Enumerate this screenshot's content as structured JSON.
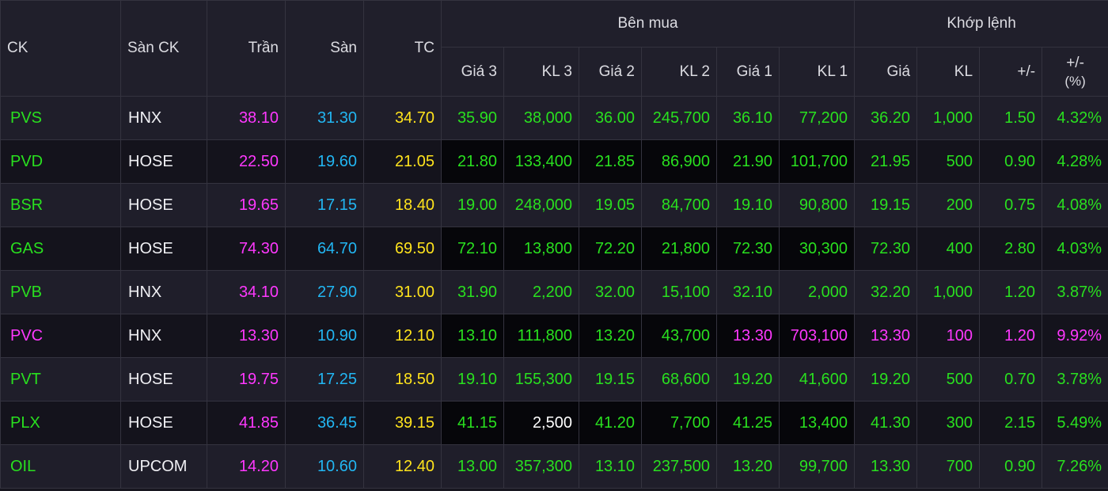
{
  "colors": {
    "ceiling": "#ff38ff",
    "floor": "#22b6f2",
    "reference": "#ffe31c",
    "up": "#29e01f",
    "flash": "#0e9a6a"
  },
  "headers": {
    "ck": "CK",
    "san_ck": "Sàn CK",
    "tran": "Trần",
    "san": "Sàn",
    "tc": "TC",
    "ben_mua": "Bên mua",
    "khop_lenh": "Khớp lệnh",
    "gia3": "Giá 3",
    "kl3": "KL 3",
    "gia2": "Giá 2",
    "kl2": "KL 2",
    "gia1": "Giá 1",
    "kl1": "KL 1",
    "gia": "Giá",
    "kl": "KL",
    "change": "+/-",
    "change_pct_line1": "+/-",
    "change_pct_line2": "(%)"
  },
  "rows": [
    {
      "ck": "PVS",
      "san_ck": "HNX",
      "tran": "38.10",
      "san": "31.30",
      "tc": "34.70",
      "gia3": "35.90",
      "kl3": "38,000",
      "gia2": "36.00",
      "kl2": "245,700",
      "gia1": "36.10",
      "kl1": "77,200",
      "gia": "36.20",
      "kl": "1,000",
      "change": "1.50",
      "change_pct": "4.32%"
    },
    {
      "ck": "PVD",
      "san_ck": "HOSE",
      "tran": "22.50",
      "san": "19.60",
      "tc": "21.05",
      "gia3": "21.80",
      "kl3": "133,400",
      "gia2": "21.85",
      "kl2": "86,900",
      "gia1": "21.90",
      "kl1": "101,700",
      "gia": "21.95",
      "kl": "500",
      "change": "0.90",
      "change_pct": "4.28%"
    },
    {
      "ck": "BSR",
      "san_ck": "HOSE",
      "tran": "19.65",
      "san": "17.15",
      "tc": "18.40",
      "gia3": "19.00",
      "kl3": "248,000",
      "gia2": "19.05",
      "kl2": "84,700",
      "gia1": "19.10",
      "kl1": "90,800",
      "gia": "19.15",
      "kl": "200",
      "change": "0.75",
      "change_pct": "4.08%"
    },
    {
      "ck": "GAS",
      "san_ck": "HOSE",
      "tran": "74.30",
      "san": "64.70",
      "tc": "69.50",
      "gia3": "72.10",
      "kl3": "13,800",
      "gia2": "72.20",
      "kl2": "21,800",
      "gia1": "72.30",
      "kl1": "30,300",
      "gia": "72.30",
      "kl": "400",
      "change": "2.80",
      "change_pct": "4.03%"
    },
    {
      "ck": "PVB",
      "san_ck": "HNX",
      "tran": "34.10",
      "san": "27.90",
      "tc": "31.00",
      "gia3": "31.90",
      "kl3": "2,200",
      "gia2": "32.00",
      "kl2": "15,100",
      "gia1": "32.10",
      "kl1": "2,000",
      "gia": "32.20",
      "kl": "1,000",
      "change": "1.20",
      "change_pct": "3.87%"
    },
    {
      "ck": "PVC",
      "san_ck": "HNX",
      "tran": "13.30",
      "san": "10.90",
      "tc": "12.10",
      "gia3": "13.10",
      "kl3": "111,800",
      "gia2": "13.20",
      "kl2": "43,700",
      "gia1": "13.30",
      "kl1": "703,100",
      "gia": "13.30",
      "kl": "100",
      "change": "1.20",
      "change_pct": "9.92%"
    },
    {
      "ck": "PVT",
      "san_ck": "HOSE",
      "tran": "19.75",
      "san": "17.25",
      "tc": "18.50",
      "gia3": "19.10",
      "kl3": "155,300",
      "gia2": "19.15",
      "kl2": "68,600",
      "gia1": "19.20",
      "kl1": "41,600",
      "gia": "19.20",
      "kl": "500",
      "change": "0.70",
      "change_pct": "3.78%"
    },
    {
      "ck": "PLX",
      "san_ck": "HOSE",
      "tran": "41.85",
      "san": "36.45",
      "tc": "39.15",
      "gia3": "41.15",
      "kl3": "2,500",
      "gia2": "41.20",
      "kl2": "7,700",
      "gia1": "41.25",
      "kl1": "13,400",
      "gia": "41.30",
      "kl": "300",
      "change": "2.15",
      "change_pct": "5.49%"
    },
    {
      "ck": "OIL",
      "san_ck": "UPCOM",
      "tran": "14.20",
      "san": "10.60",
      "tc": "12.40",
      "gia3": "13.00",
      "kl3": "357,300",
      "gia2": "13.10",
      "kl2": "237,500",
      "gia1": "13.20",
      "kl1": "99,700",
      "gia": "13.30",
      "kl": "700",
      "change": "0.90",
      "change_pct": "7.26%"
    }
  ]
}
